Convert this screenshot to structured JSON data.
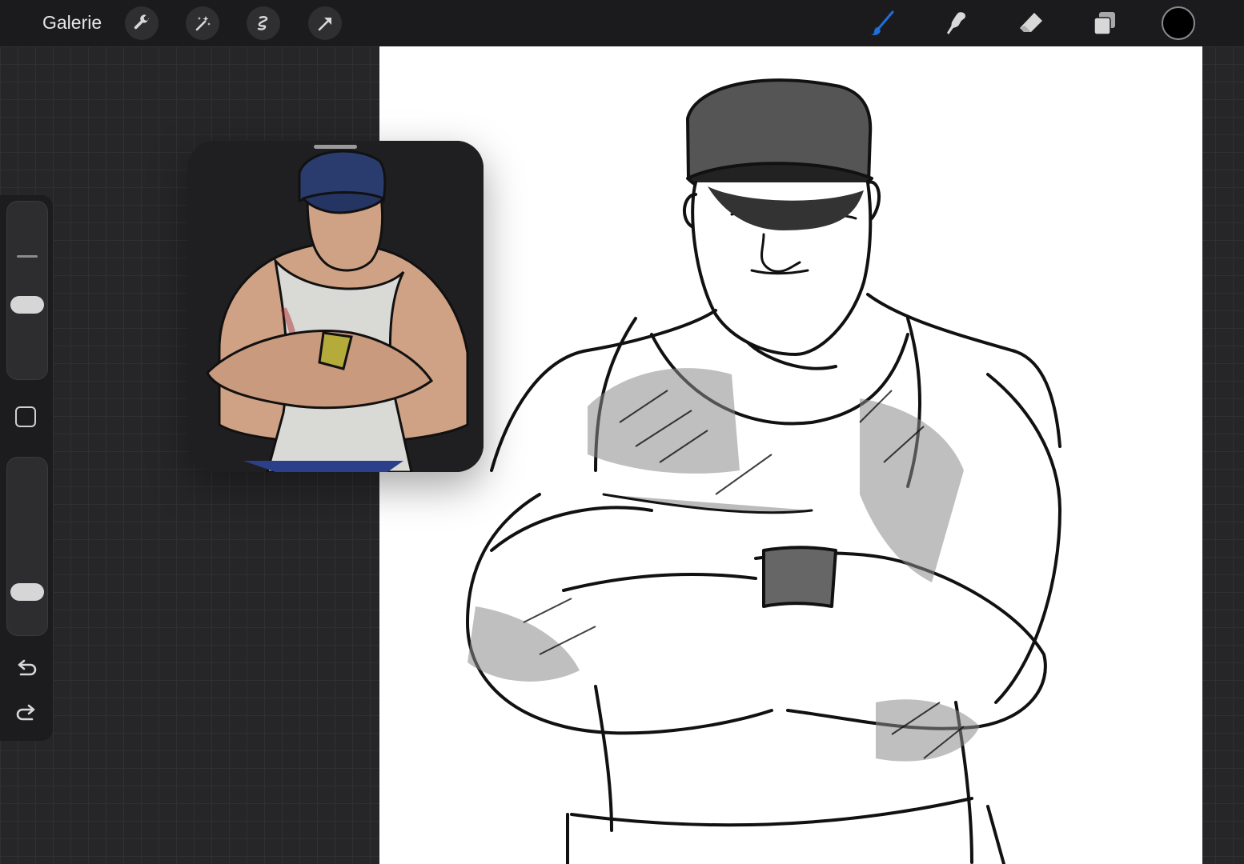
{
  "app": {
    "gallery_label": "Galerie"
  },
  "toolbar_left": [
    {
      "icon": "wrench-icon",
      "label": "actions"
    },
    {
      "icon": "magic-wand-icon",
      "label": "adjustments"
    },
    {
      "icon": "selection-icon",
      "label": "selection"
    },
    {
      "icon": "transform-arrow-icon",
      "label": "transform"
    }
  ],
  "toolbar_right": [
    {
      "icon": "brush-icon",
      "active": true
    },
    {
      "icon": "smudge-icon",
      "active": false
    },
    {
      "icon": "eraser-icon",
      "active": false
    },
    {
      "icon": "layers-icon",
      "active": false
    }
  ],
  "colors": {
    "current_color": "#000000",
    "active_tool": "#1e6fd9",
    "toolbar_bg": "#1b1b1d",
    "canvas_bg": "#ffffff"
  },
  "sidebar": {
    "brush_size_level": 0.38,
    "opacity_level": 0.15
  }
}
